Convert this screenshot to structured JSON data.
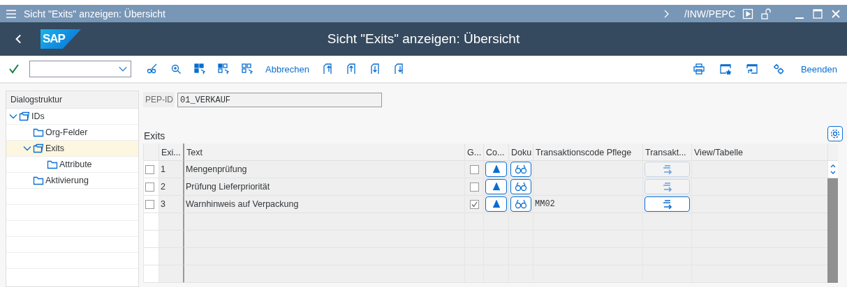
{
  "window": {
    "title": "Sicht \"Exits\" anzeigen: Übersicht",
    "system": "/INW/PEPC"
  },
  "header": {
    "logo_text": "SAP",
    "title": "Sicht \"Exits\" anzeigen: Übersicht"
  },
  "toolbar": {
    "buttons": [
      {
        "kind": "icon"
      },
      {
        "kind": "icon"
      },
      {
        "kind": "icon"
      },
      {
        "kind": "icon"
      },
      {
        "kind": "icon"
      },
      {
        "kind": "text",
        "label": "Abbrechen"
      },
      {
        "kind": "icon"
      },
      {
        "kind": "icon"
      },
      {
        "kind": "icon"
      },
      {
        "kind": "icon"
      }
    ],
    "right_buttons": [
      {
        "kind": "icon"
      },
      {
        "kind": "icon"
      },
      {
        "kind": "icon"
      },
      {
        "kind": "icon"
      },
      {
        "kind": "text",
        "label": "Beenden"
      }
    ]
  },
  "dialog_structure": {
    "title": "Dialogstruktur",
    "items": [
      {
        "label": "IDs",
        "expanded": true,
        "selected": false,
        "children": [
          {
            "label": "Org-Felder",
            "selected": false
          },
          {
            "label": "Exits",
            "expanded": true,
            "selected": true,
            "children": [
              {
                "label": "Attribute",
                "selected": false
              }
            ]
          },
          {
            "label": "Aktivierung",
            "selected": false
          }
        ]
      }
    ]
  },
  "pep_id": {
    "label": "PEP-ID",
    "value": "01_VERKAUF"
  },
  "table": {
    "title": "Exits",
    "columns": [
      "Exi...",
      "Text",
      "G...",
      "Co...",
      "Doku",
      "Transaktionscode Pflege",
      "Transakt...",
      "View/Tabelle"
    ],
    "rows": [
      {
        "selected": false,
        "exit": "1",
        "text": "Mengenprüfung",
        "g_checked": false,
        "tcode": "",
        "transaction_enabled": false,
        "view": ""
      },
      {
        "selected": false,
        "exit": "2",
        "text": "Prüfung Lieferpriorität",
        "g_checked": false,
        "tcode": "",
        "transaction_enabled": false,
        "view": ""
      },
      {
        "selected": false,
        "exit": "3",
        "text": "Warnhinweis auf Verpackung",
        "g_checked": true,
        "tcode": "MM02",
        "transaction_enabled": true,
        "view": ""
      }
    ]
  }
}
